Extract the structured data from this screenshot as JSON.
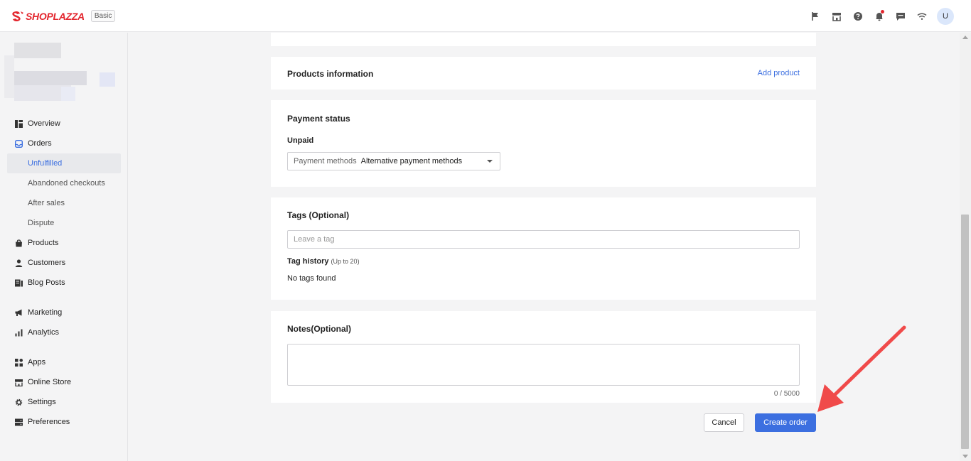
{
  "header": {
    "brand": "SHOPLAZZA",
    "plan_badge": "Basic",
    "avatar_initial": "U",
    "icons": [
      "flag-icon",
      "store-icon",
      "help-icon",
      "bell-icon",
      "message-icon",
      "wifi-icon"
    ]
  },
  "sidebar": {
    "items": [
      {
        "label": "Overview",
        "icon": "overview-icon"
      },
      {
        "label": "Orders",
        "icon": "orders-icon"
      },
      {
        "label": "Unfulfilled",
        "sub": true,
        "active": true
      },
      {
        "label": "Abandoned checkouts",
        "sub": true
      },
      {
        "label": "After sales",
        "sub": true
      },
      {
        "label": "Dispute",
        "sub": true
      },
      {
        "label": "Products",
        "icon": "products-icon"
      },
      {
        "label": "Customers",
        "icon": "customers-icon"
      },
      {
        "label": "Blog Posts",
        "icon": "blog-icon"
      },
      {
        "label": "Marketing",
        "icon": "megaphone-icon"
      },
      {
        "label": "Analytics",
        "icon": "analytics-icon"
      },
      {
        "label": "Apps",
        "icon": "apps-icon"
      },
      {
        "label": "Online Store",
        "icon": "store-icon"
      },
      {
        "label": "Settings",
        "icon": "gear-icon"
      },
      {
        "label": "Preferences",
        "icon": "preferences-icon"
      }
    ]
  },
  "products": {
    "title": "Products information",
    "add_link": "Add product"
  },
  "payment": {
    "title": "Payment status",
    "status": "Unpaid",
    "select_prefix": "Payment methods",
    "select_value": "Alternative payment methods"
  },
  "tags": {
    "title": "Tags (Optional)",
    "placeholder": "Leave a tag",
    "history_label": "Tag history",
    "history_limit": "(Up to 20)",
    "empty": "No tags found"
  },
  "notes": {
    "title": "Notes(Optional)",
    "counter": "0 / 5000"
  },
  "actions": {
    "cancel": "Cancel",
    "create": "Create order"
  },
  "colors": {
    "accent": "#3c6fe0",
    "brand": "#e3262e",
    "annotation_arrow": "#f04a4a"
  }
}
